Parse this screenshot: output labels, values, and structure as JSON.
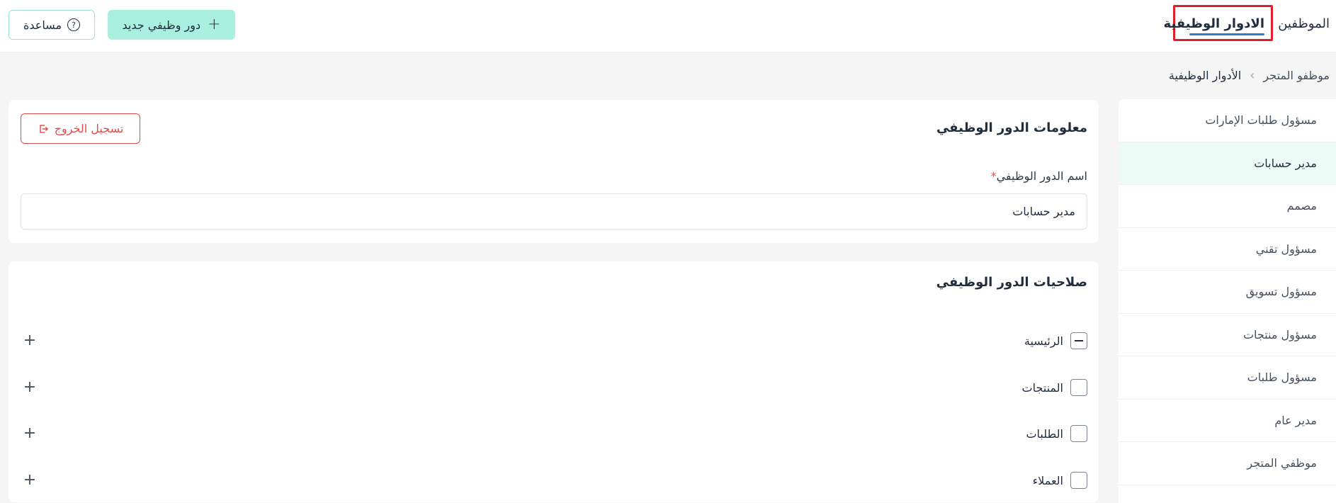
{
  "header": {
    "tabs": [
      "الموظفين",
      "الادوار الوظيفية"
    ],
    "new_role_label": "دور وظيفي جديد",
    "help_label": "مساعدة"
  },
  "breadcrumb": {
    "parent": "موظفو المتجر",
    "current": "الأدوار الوظيفية"
  },
  "sidebar": {
    "items": [
      {
        "label": "مسؤول طلبات الإمارات"
      },
      {
        "label": "مدير حسابات",
        "active": true
      },
      {
        "label": "مصمم"
      },
      {
        "label": "مسؤول تقني"
      },
      {
        "label": "مسؤول تسويق"
      },
      {
        "label": "مسؤول منتجات"
      },
      {
        "label": "مسؤول طلبات"
      },
      {
        "label": "مدير عام"
      },
      {
        "label": "موظفي المتجر"
      }
    ]
  },
  "role_info": {
    "title": "معلومات الدور الوظيفي",
    "logout_label": "تسجيل الخروج",
    "name_label": "اسم الدور الوظيفي",
    "required_mark": "*",
    "name_value": "مدير حسابات"
  },
  "permissions": {
    "title": "صلاحيات الدور الوظيفي",
    "items": [
      {
        "label": "الرئيسية",
        "state": "indeterminate"
      },
      {
        "label": "المنتجات",
        "state": "unchecked"
      },
      {
        "label": "الطلبات",
        "state": "unchecked"
      },
      {
        "label": "العملاء",
        "state": "unchecked"
      }
    ]
  },
  "colors": {
    "accent": "#a9f0de",
    "danger": "#e34b4b",
    "highlight_box": "#e0202b",
    "active_row": "#ecfbf5"
  }
}
